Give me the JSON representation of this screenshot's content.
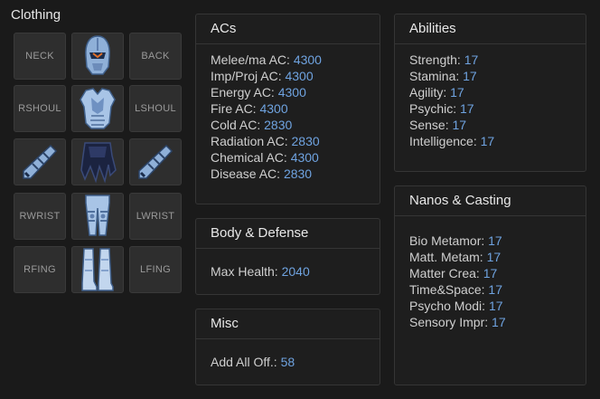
{
  "clothing": {
    "title": "Clothing",
    "slots": {
      "neck": "NECK",
      "back": "BACK",
      "rshoul": "RSHOUL",
      "lshoul": "LSHOUL",
      "rwrist": "RWRIST",
      "lwrist": "LWRIST",
      "rfing": "RFING",
      "lfing": "LFING"
    },
    "icons": {
      "head": "helmet-icon",
      "body": "chest-armor-icon",
      "rarm": "sleeve-icon",
      "larm": "sleeve-icon",
      "hands": "gloves-icon",
      "legs": "leg-armor-icon",
      "feet": "boots-icon"
    }
  },
  "acs": {
    "title": "ACs",
    "rows": [
      {
        "label": "Melee/ma AC:",
        "value": "4300"
      },
      {
        "label": "Imp/Proj AC:",
        "value": "4300"
      },
      {
        "label": "Energy AC:",
        "value": "4300"
      },
      {
        "label": "Fire AC:",
        "value": "4300"
      },
      {
        "label": "Cold AC:",
        "value": "2830"
      },
      {
        "label": "Radiation AC:",
        "value": "2830"
      },
      {
        "label": "Chemical AC:",
        "value": "4300"
      },
      {
        "label": "Disease AC:",
        "value": "2830"
      }
    ]
  },
  "body_defense": {
    "title": "Body & Defense",
    "rows": [
      {
        "label": "Max Health:",
        "value": "2040"
      }
    ]
  },
  "misc": {
    "title": "Misc",
    "rows": [
      {
        "label": "Add All Off.:",
        "value": "58"
      }
    ]
  },
  "abilities": {
    "title": "Abilities",
    "rows": [
      {
        "label": "Strength:",
        "value": "17"
      },
      {
        "label": "Stamina:",
        "value": "17"
      },
      {
        "label": "Agility:",
        "value": "17"
      },
      {
        "label": "Psychic:",
        "value": "17"
      },
      {
        "label": "Sense:",
        "value": "17"
      },
      {
        "label": "Intelligence:",
        "value": "17"
      }
    ]
  },
  "nanos": {
    "title": "Nanos & Casting",
    "rows": [
      {
        "label": "Bio Metamor:",
        "value": "17"
      },
      {
        "label": "Matt. Metam:",
        "value": "17"
      },
      {
        "label": "Matter Crea:",
        "value": "17"
      },
      {
        "label": "Time&Space:",
        "value": "17"
      },
      {
        "label": "Psycho Modi:",
        "value": "17"
      },
      {
        "label": "Sensory Impr:",
        "value": "17"
      }
    ]
  },
  "colors": {
    "background": "#1a1a1a",
    "value": "#6fa3e0",
    "panel_border": "#353535"
  }
}
